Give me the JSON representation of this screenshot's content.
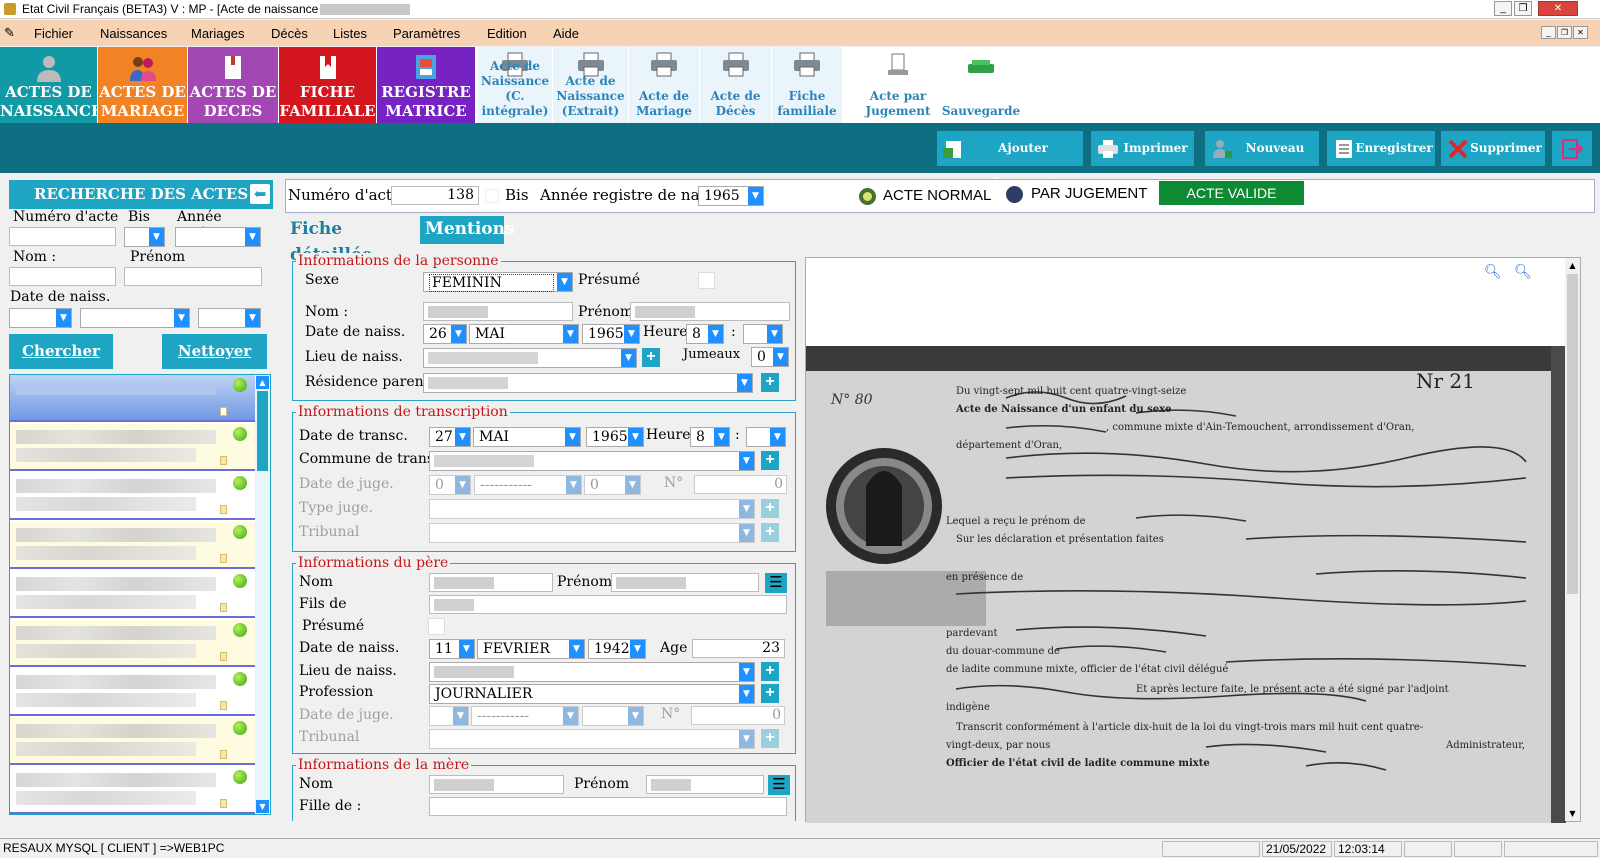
{
  "window": {
    "title": "Etat Civil Français (BETA3)  V : MP  - [Acte de naissance :"
  },
  "menu": [
    "Fichier",
    "Naissances",
    "Mariages",
    "Décès",
    "Listes",
    "Paramètres",
    "Edition",
    "Aide"
  ],
  "big_buttons": [
    {
      "line1": "ACTES DE",
      "line2": "NAISSANCE",
      "color": "#119aa6"
    },
    {
      "line1": "ACTES DE",
      "line2": "MARIAGE",
      "color": "#f28325"
    },
    {
      "line1": "ACTES DE",
      "line2": "DECES",
      "color": "#a347b4"
    },
    {
      "line1": "FICHE",
      "line2": "FAMILIALE",
      "color": "#d4161f"
    },
    {
      "line1": "REGISTRE",
      "line2": "MATRICE",
      "color": "#7722c3"
    }
  ],
  "small_buttons": [
    {
      "l1": "Acte de",
      "l2": "Naissance",
      "l3": "(C. intégrale)"
    },
    {
      "l1": "Acte de",
      "l2": "Naissance",
      "l3": "(Extrait)"
    },
    {
      "l1": "Acte de",
      "l2": "Mariage",
      "l3": ""
    },
    {
      "l1": "Acte de",
      "l2": "Décès",
      "l3": ""
    },
    {
      "l1": "Fiche",
      "l2": "familiale",
      "l3": ""
    },
    {
      "l1": "Acte par",
      "l2": "Jugement",
      "l3": ""
    },
    {
      "l1": "Sauvegarde",
      "l2": "",
      "l3": ""
    }
  ],
  "actions": [
    "Ajouter document",
    "Imprimer",
    "Nouveau",
    "Enregistrer",
    "Supprimer"
  ],
  "search": {
    "title": "RECHERCHE DES ACTES",
    "num_label": "Numéro d'acte",
    "bis_label": "Bis",
    "annee_label": "Année registre",
    "nom_label": "Nom :",
    "prenom_label": "Prénom",
    "date_label": "Date de naiss.",
    "chercher": "Chercher",
    "nettoyer": "Nettoyer"
  },
  "header": {
    "numero_label": "Numéro d'acte",
    "numero": "138",
    "bis_label": "Bis",
    "annee_label": "Année registre de naiss.",
    "annee": "1965",
    "normal": "ACTE NORMAL",
    "jugement": "PAR JUGEMENT",
    "status": "ACTE VALIDE"
  },
  "tabs": {
    "fiche": "Fiche détaillée",
    "mentions": "Mentions"
  },
  "personne": {
    "title": "Informations de la personne",
    "sexe_label": "Sexe",
    "sexe": "FEMININ",
    "presume_label": "Présumé",
    "nom_label": "Nom :",
    "prenom_label": "Prénom",
    "date_label": "Date de naiss.",
    "jour": "26",
    "mois": "MAI",
    "annee": "1965",
    "heure_label": "Heure",
    "heure": "8",
    "min_sep": ":",
    "lieu_label": "Lieu de naiss.",
    "jumeaux_label": "Jumeaux",
    "jumeaux": "0",
    "residence_label": "Résidence parents"
  },
  "transcription": {
    "title": "Informations de transcription",
    "date_label": "Date de transc.",
    "jour": "27",
    "mois": "MAI",
    "annee": "1965",
    "heure_label": "Heure",
    "heure": "8",
    "commune_label": "Commune de transc.",
    "date_juge_label": "Date de juge.",
    "dj_jour": "0",
    "dj_mois": "-----------",
    "dj_annee": "0",
    "no_label": "N°",
    "no": "0",
    "type_label": "Type juge.",
    "tribunal_label": "Tribunal"
  },
  "pere": {
    "title": "Informations du père",
    "nom_label": "Nom",
    "prenom_label": "Prénom",
    "fils_label": "Fils de",
    "presume_label": "Présumé",
    "date_label": "Date de naiss.",
    "jour": "11",
    "mois": "FEVRIER",
    "annee": "1942",
    "age_label": "Age",
    "age": "23",
    "lieu_label": "Lieu de naiss.",
    "profession_label": "Profession",
    "profession": "JOURNALIER",
    "date_juge_label": "Date de juge.",
    "dj_mois": "-----------",
    "no_label": "N°",
    "no": "0",
    "tribunal_label": "Tribunal"
  },
  "mere": {
    "title": "Informations de la mère",
    "nom_label": "Nom",
    "prenom_label": "Prénom",
    "fille_label": "Fille de :"
  },
  "document": {
    "line1": "Du vingt-sept mil huit cent quatre-vingt-seize",
    "line2": "Acte de Naissance d'un enfant du sexe",
    "line3": ", commune mixte d'Ain-Temouchent, arrondissement d'Oran,",
    "line4": "département d'Oran,",
    "line5": "Lequel a reçu le prénom de",
    "line6": "Sur les déclaration et présentation faites",
    "line7": "en présence de",
    "line8": "pardevant",
    "line9": "du douar-commune de",
    "line10": "de ladite commune mixte, officier de l'état civil délégué",
    "line11": "Et après lecture faite, le présent acte a été signé par l'adjoint",
    "line12": "indigène",
    "line13": "Transcrit conformément à l'article dix-huit de la loi du vingt-trois mars mil huit cent quatre-",
    "line14": "vingt-deux, par nous",
    "line15": "Administrateur,",
    "line16": "Officier de l'état civil de ladite commune mixte",
    "no": "N° 80",
    "no2": "Nr 21"
  },
  "status": {
    "conn": "RESAUX MYSQL [ CLIENT ] =>WEB1PC",
    "date": "21/05/2022",
    "time": "12:03:14"
  }
}
